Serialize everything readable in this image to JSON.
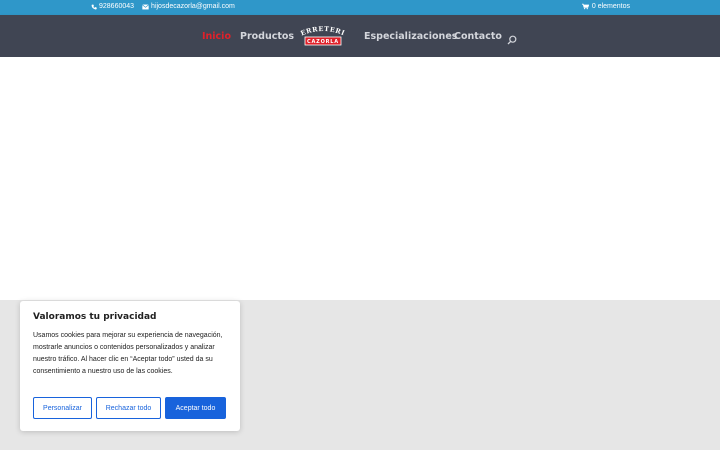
{
  "topbar": {
    "phone": "928660043",
    "email": "hijosdecazorla@gmail.com",
    "cart": "0 elementos"
  },
  "nav": {
    "items": [
      {
        "label": "Inicio",
        "active": true
      },
      {
        "label": "Productos",
        "active": false
      },
      {
        "label": "Especializaciones",
        "active": false
      },
      {
        "label": "Contacto",
        "active": false
      }
    ],
    "logo": {
      "line1": "FERRETERIA",
      "line2": "CAZORLA"
    }
  },
  "cookie": {
    "title": "Valoramos tu privacidad",
    "body": "Usamos cookies para mejorar su experiencia de navegación, mostrarle anuncios o contenidos personalizados y analizar nuestro tráfico. Al hacer clic en “Aceptar todo” usted da su consentimiento a nuestro uso de las cookies.",
    "buttons": {
      "customize": "Personalizar",
      "reject": "Rechazar todo",
      "accept": "Aceptar todo"
    }
  },
  "colors": {
    "topbar": "#2f97c9",
    "header": "#404553",
    "active": "#e0212a",
    "accent": "#1863dc"
  },
  "icons": [
    "phone-icon",
    "mail-icon",
    "cart-icon",
    "search-icon"
  ]
}
